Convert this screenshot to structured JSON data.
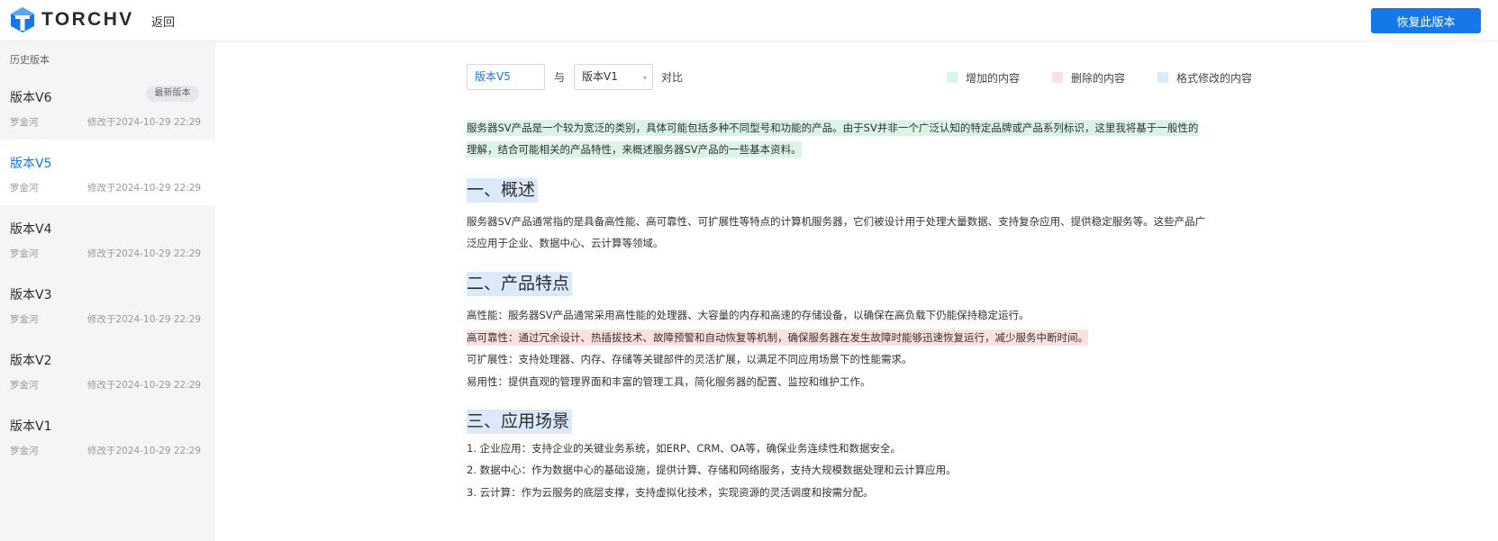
{
  "header": {
    "logo_text": "TORCHV",
    "back_label": "返回",
    "restore_label": "恢复此版本"
  },
  "sidebar": {
    "title": "历史版本",
    "items": [
      {
        "name": "版本V6",
        "author": "罗金河",
        "time": "修改于2024-10-29 22:29",
        "badge": "最新版本"
      },
      {
        "name": "版本V5",
        "author": "罗金河",
        "time": "修改于2024-10-29 22:29"
      },
      {
        "name": "版本V4",
        "author": "罗金河",
        "time": "修改于2024-10-29 22:29"
      },
      {
        "name": "版本V3",
        "author": "罗金河",
        "time": "修改于2024-10-29 22:29"
      },
      {
        "name": "版本V2",
        "author": "罗金河",
        "time": "修改于2024-10-29 22:29"
      },
      {
        "name": "版本V1",
        "author": "罗金河",
        "time": "修改于2024-10-29 22:29"
      }
    ]
  },
  "compare": {
    "current_version": "版本V5",
    "with_label": "与",
    "target_version": "版本V1",
    "compare_label": "对比"
  },
  "legend": {
    "added": "增加的内容",
    "deleted": "删除的内容",
    "format": "格式修改的内容",
    "colors": {
      "added": "#daf4e8",
      "deleted": "#fde1e1",
      "format": "#dce9fb"
    }
  },
  "doc": {
    "intro_1": "服务器SV产品是一个较为宽泛的类别，具体可能包括多种不同型号和功能的产品。由于SV并非一个广泛认知的特定品牌或产品系列标识，这里我将基于一般性的",
    "intro_2": "理解，结合可能相关的产品特性，来概述服务器SV产品的一些基本资料。",
    "h1": "一、概述",
    "overview_1": "服务器SV产品通常指的是具备高性能、高可靠性、可扩展性等特点的计算机服务器，它们被设计用于处理大量数据、支持复杂应用、提供稳定服务等。这些产品广",
    "overview_2": "泛应用于企业、数据中心、云计算等领域。",
    "h2": "二、产品特点",
    "feat_1": "高性能：服务器SV产品通常采用高性能的处理器、大容量的内存和高速的存储设备，以确保在高负载下仍能保持稳定运行。",
    "feat_2": "高可靠性：通过冗余设计、热插拔技术、故障预警和自动恢复等机制，确保服务器在发生故障时能够迅速恢复运行，减少服务中断时间。",
    "feat_3": "可扩展性：支持处理器、内存、存储等关键部件的灵活扩展，以满足不同应用场景下的性能需求。",
    "feat_4": "易用性：提供直观的管理界面和丰富的管理工具，简化服务器的配置、监控和维护工作。",
    "h3": "三、应用场景",
    "scene_1": "1. 企业应用：支持企业的关键业务系统，如ERP、CRM、OA等，确保业务连续性和数据安全。",
    "scene_2": "2. 数据中心：作为数据中心的基础设施，提供计算、存储和网络服务，支持大规模数据处理和云计算应用。",
    "scene_3": "3. 云计算：作为云服务的底层支撑，支持虚拟化技术，实现资源的灵活调度和按需分配。"
  }
}
